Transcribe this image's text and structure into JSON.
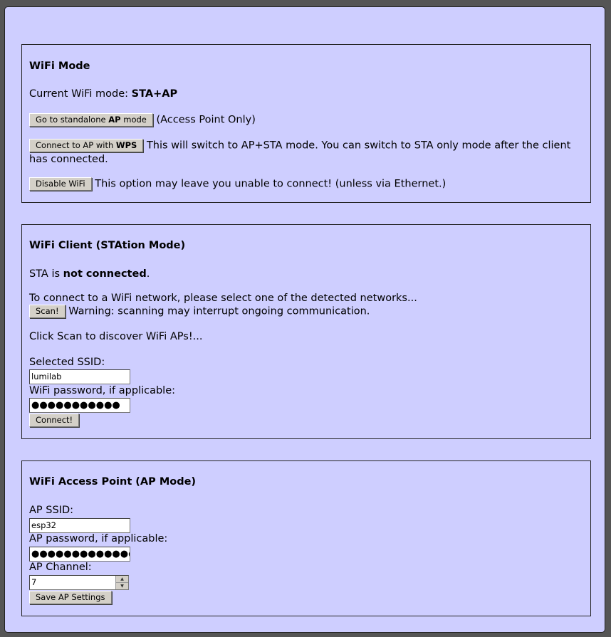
{
  "mode_panel": {
    "title": "WiFi Mode",
    "current_label": "Current WiFi mode: ",
    "current_value": "STA+AP",
    "ap_btn_pre": "Go to standalone ",
    "ap_btn_bold": "AP",
    "ap_btn_post": " mode",
    "ap_desc": "(Access Point Only)",
    "wps_btn_pre": "Connect to AP with ",
    "wps_btn_bold": "WPS",
    "wps_desc": "This will switch to AP+STA mode. You can switch to STA only mode after the client has connected.",
    "disable_btn": "Disable WiFi",
    "disable_desc": "This option may leave you unable to connect! (unless via Ethernet.)"
  },
  "client_panel": {
    "title": "WiFi Client (STAtion Mode)",
    "status_pre": "STA is ",
    "status_value": "not connected",
    "status_post": ".",
    "instructions": "To connect to a WiFi network, please select one of the detected networks...",
    "scan_btn": "Scan!",
    "scan_warning": "Warning: scanning may interrupt ongoing communication.",
    "scan_hint": "Click Scan to discover WiFi APs!...",
    "ssid_label": "Selected SSID:",
    "ssid_value": "lumilab",
    "password_label": "WiFi password, if applicable:",
    "password_value": "●●●●●●●●●●●",
    "connect_btn": "Connect!"
  },
  "ap_panel": {
    "title": "WiFi Access Point (AP Mode)",
    "ssid_label": "AP SSID:",
    "ssid_value": "esp32",
    "password_label": "AP password, if applicable:",
    "password_value": "●●●●●●●●●●●●●●●",
    "channel_label": "AP Channel:",
    "channel_value": "7",
    "save_btn": "Save AP Settings"
  }
}
